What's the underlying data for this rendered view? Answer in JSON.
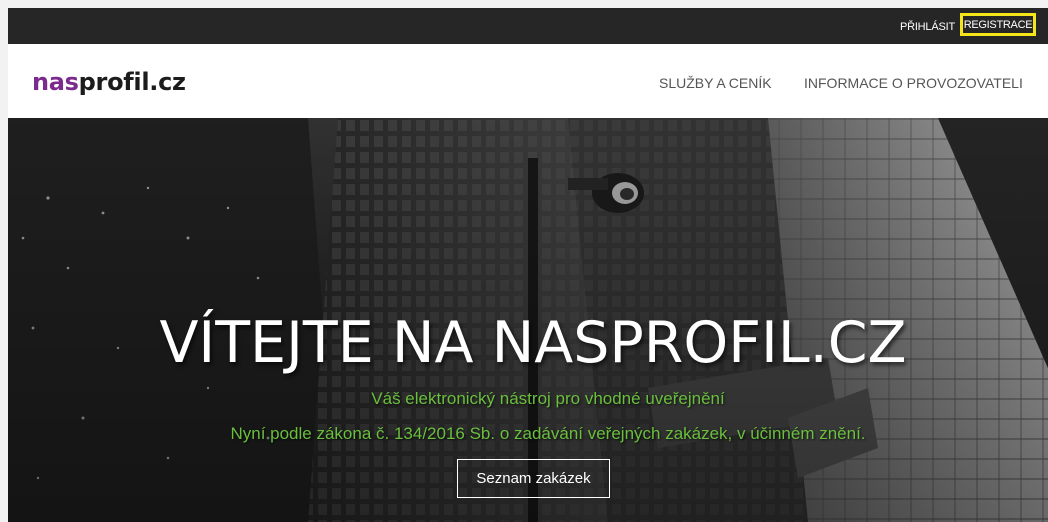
{
  "topbar": {
    "login_label": "PŘIHLÁSIT",
    "register_label": "REGISTRACE",
    "highlight_color": "#f5e61a"
  },
  "header": {
    "logo_part_1": "nas",
    "logo_part_2": "profil.cz",
    "logo_colors": [
      "#7a2b8c",
      "#1c1c1c"
    ],
    "nav": [
      {
        "label": "SLUŽBY A CENÍK"
      },
      {
        "label": "INFORMACE O PROVOZOVATELI"
      }
    ]
  },
  "hero": {
    "title": "VÍTEJTE NA NASPROFIL.CZ",
    "subtitle_1": "Váš elektronický nástroj pro vhodné uveřejnění",
    "subtitle_2": "Nyní podle zákona č. 134/2016 Sb. o zadávání veřejných zakázek, v účinném znění.",
    "subtitle_color": "#6abf3d",
    "button_label": "Seznam zakázek"
  }
}
